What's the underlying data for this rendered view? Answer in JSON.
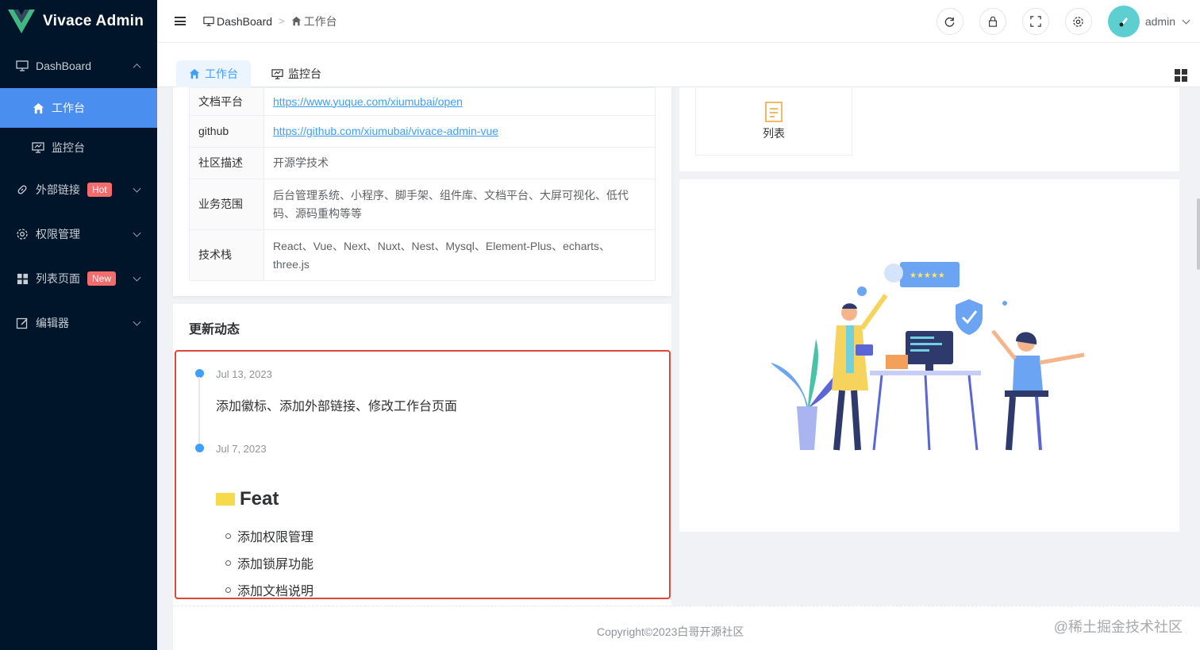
{
  "app": {
    "title": "Vivace Admin"
  },
  "sidebar": {
    "items": [
      {
        "label": "DashBoard",
        "icon": "monitor-icon",
        "expanded": true,
        "children": [
          {
            "label": "工作台",
            "icon": "home-icon",
            "active": true
          },
          {
            "label": "监控台",
            "icon": "monitor-icon",
            "active": false
          }
        ]
      },
      {
        "label": "外部链接",
        "icon": "link-icon",
        "badge": "Hot"
      },
      {
        "label": "权限管理",
        "icon": "gear-icon"
      },
      {
        "label": "列表页面",
        "icon": "grid-icon",
        "badge": "New"
      },
      {
        "label": "编辑器",
        "icon": "edit-icon"
      }
    ]
  },
  "header": {
    "breadcrumb": [
      "DashBoard",
      "工作台"
    ],
    "user": "admin",
    "tools": [
      "refresh-icon",
      "lock-icon",
      "fullscreen-icon",
      "settings-icon"
    ]
  },
  "tabs": [
    {
      "label": "工作台",
      "active": true
    },
    {
      "label": "监控台",
      "active": false
    }
  ],
  "info_table": [
    {
      "label": "文档平台",
      "value": "https://www.yuque.com/xiumubai/open",
      "link": true
    },
    {
      "label": "github",
      "value": "https://github.com/xiumubai/vivace-admin-vue",
      "link": true
    },
    {
      "label": "社区描述",
      "value": "开源学技术",
      "link": false
    },
    {
      "label": "业务范围",
      "value": "后台管理系统、小程序、脚手架、组件库、文档平台、大屏可视化、低代码、源码重构等等",
      "link": false
    },
    {
      "label": "技术栈",
      "value": "React、Vue、Next、Nuxt、Nest、Mysql、Element-Plus、echarts、three.js",
      "link": false
    }
  ],
  "news": {
    "title": "更新动态",
    "entries": [
      {
        "date": "Jul 13, 2023",
        "text": "添加徽标、添加外部链接、修改工作台页面"
      },
      {
        "date": "Jul 7, 2023",
        "heading": "Feat",
        "items": [
          "添加权限管理",
          "添加锁屏功能",
          "添加文档说明"
        ]
      }
    ]
  },
  "quick": {
    "label": "列表"
  },
  "footer": {
    "copyright": "Copyright©2023白哥开源社区",
    "watermark": "@稀土掘金技术社区"
  },
  "colors": {
    "sidebar_bg": "#001529",
    "active": "#4a8ef0",
    "primary": "#409eff",
    "highlight_border": "#e0463a"
  }
}
